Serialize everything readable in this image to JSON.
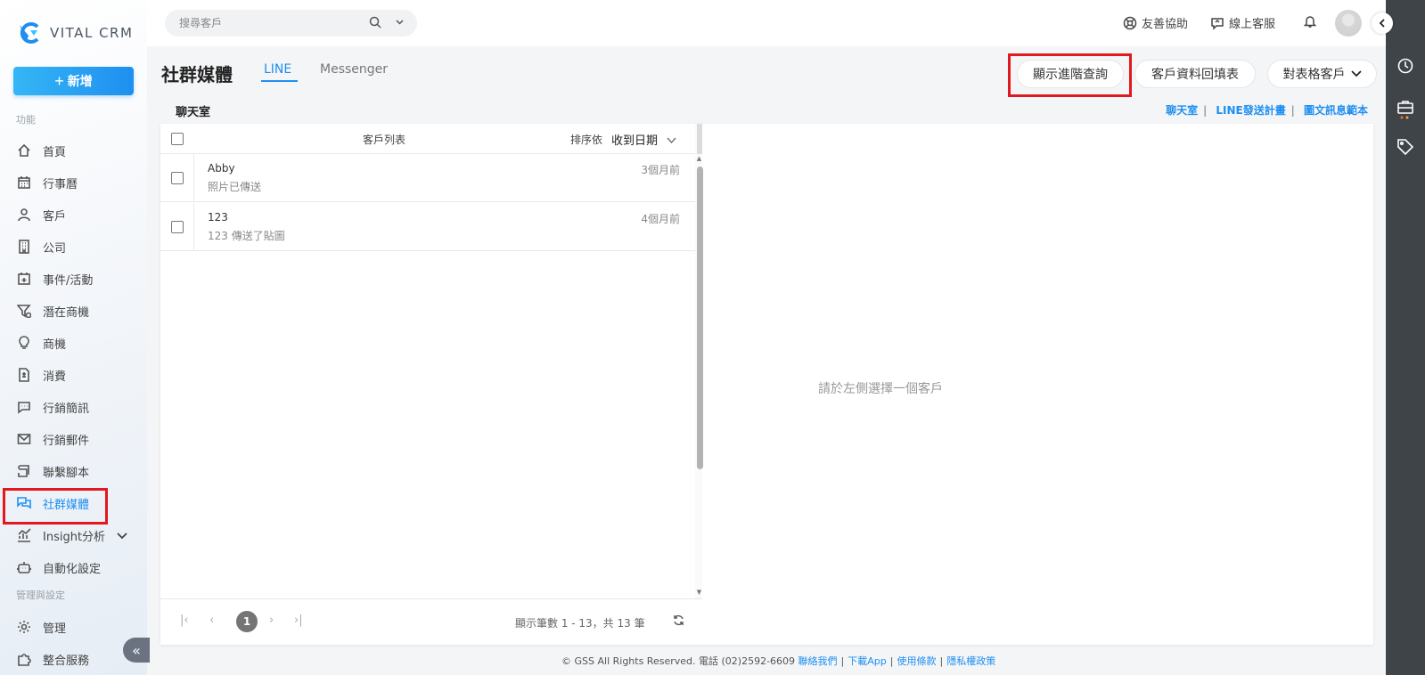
{
  "brand": {
    "name": "VITAL CRM"
  },
  "sidebar": {
    "new_label": "新增",
    "section_function": "功能",
    "section_admin": "管理與設定",
    "items": [
      {
        "label": "首頁"
      },
      {
        "label": "行事曆"
      },
      {
        "label": "客戶"
      },
      {
        "label": "公司"
      },
      {
        "label": "事件/活動"
      },
      {
        "label": "潛在商機"
      },
      {
        "label": "商機"
      },
      {
        "label": "消費"
      },
      {
        "label": "行銷簡訊"
      },
      {
        "label": "行銷郵件"
      },
      {
        "label": "聯繫腳本"
      },
      {
        "label": "社群媒體"
      },
      {
        "label": "Insight分析"
      },
      {
        "label": "自動化設定"
      }
    ],
    "admin_items": [
      {
        "label": "管理"
      },
      {
        "label": "整合服務"
      }
    ]
  },
  "topbar": {
    "search_placeholder": "搜尋客戶",
    "assist_label": "友善協助",
    "support_label": "線上客服"
  },
  "page": {
    "title": "社群媒體",
    "tabs": [
      {
        "label": "LINE",
        "active": true
      },
      {
        "label": "Messenger",
        "active": false
      }
    ],
    "actions": {
      "advanced_query": "顯示進階查詢",
      "customer_form": "客戶資料回填表",
      "table_customers": "對表格客戶"
    },
    "section_label": "聊天室",
    "quick_links": [
      "聊天室",
      "LINE發送計畫",
      "圖文訊息範本"
    ]
  },
  "customer_list": {
    "title": "客戶列表",
    "sort_label": "排序依",
    "sort_value": "收到日期",
    "rows": [
      {
        "name": "Abby",
        "message": "照片已傳送",
        "time": "3個月前"
      },
      {
        "name": "123",
        "message": "123 傳送了貼圖",
        "time": "4個月前"
      }
    ],
    "pagination": {
      "current_page": "1",
      "summary": "顯示筆數 1 - 13，共 13 筆"
    }
  },
  "detail": {
    "empty_message": "請於左側選擇一個客戶"
  },
  "footer": {
    "copyright": "© GSS All Rights Reserved. 電話 (02)2592-6609",
    "links": [
      "聯絡我們",
      "下載App",
      "使用條款",
      "隱私權政策"
    ]
  },
  "colors": {
    "accent": "#1e8ff0",
    "highlight": "#e1191f",
    "rail": "#3f4449"
  }
}
